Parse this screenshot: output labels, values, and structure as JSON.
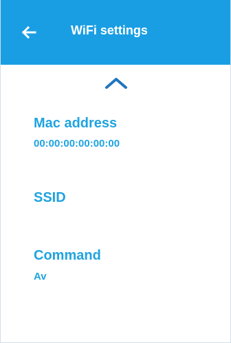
{
  "header": {
    "back_icon": "arrow-left-icon",
    "title": "WiFi settings",
    "background_color": "#1a9ee3"
  },
  "collapse": {
    "icon": "chevron-up-icon"
  },
  "fields": {
    "mac_address": {
      "label": "Mac address",
      "value": "00:00:00:00:00:00"
    },
    "ssid": {
      "label": "SSID",
      "value": ""
    },
    "command": {
      "label": "Command",
      "value": "Av"
    }
  },
  "accent_color": "#1fa3e0"
}
